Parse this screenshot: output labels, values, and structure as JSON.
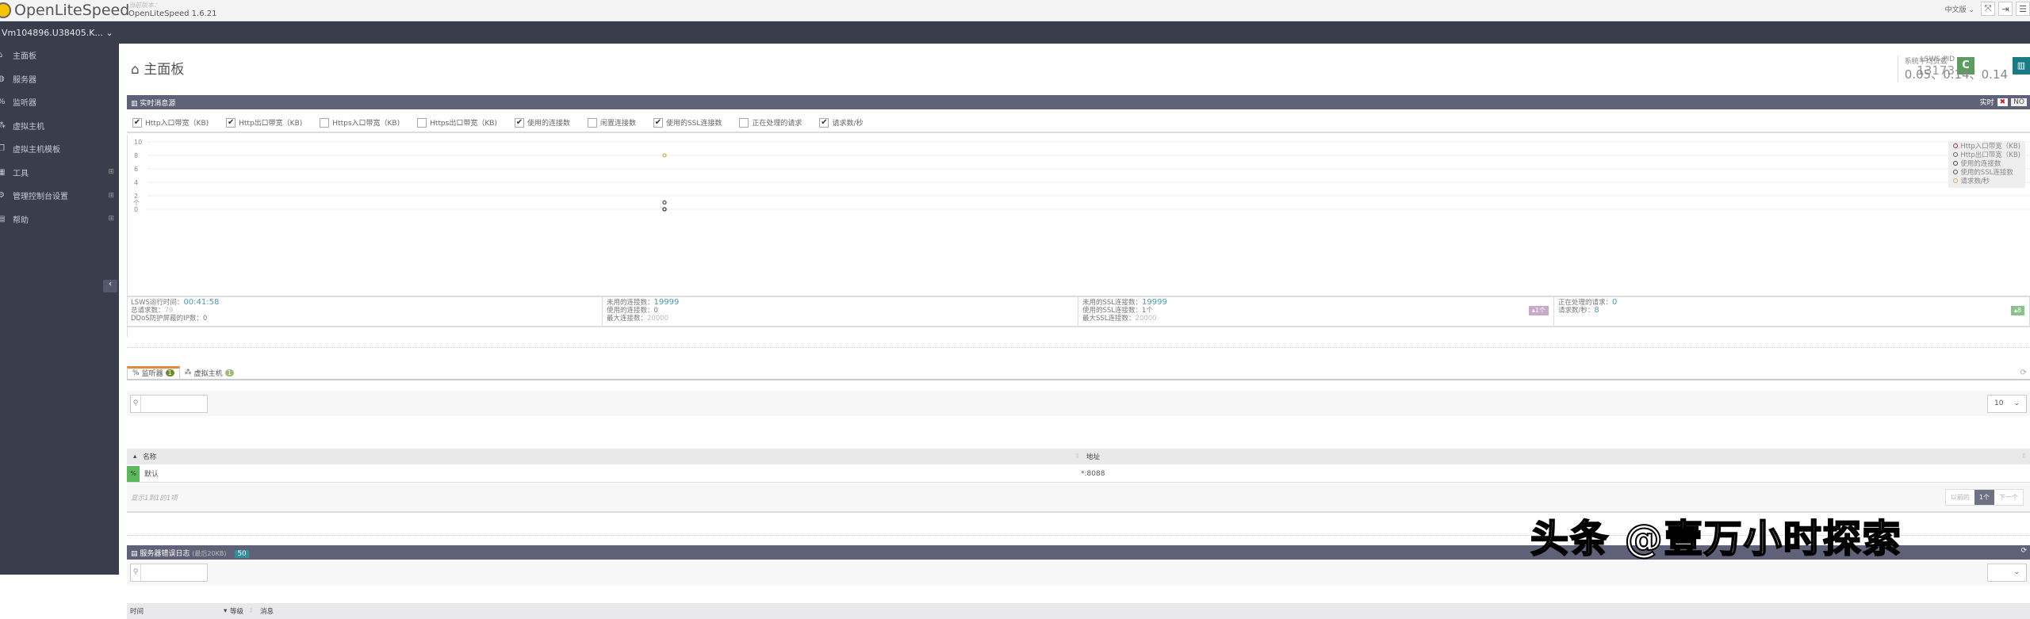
{
  "header": {
    "logo": "OpenLiteSpeed",
    "version_label": "当前版本：",
    "version": "OpenLiteSpeed 1.6.21",
    "language": "中文版",
    "server": "Vm104896.U38405.K..."
  },
  "sidebar": {
    "items": [
      {
        "label": "主面板",
        "icon": "home-icon"
      },
      {
        "label": "服务器",
        "icon": "globe-icon"
      },
      {
        "label": "监听器",
        "icon": "link-icon"
      },
      {
        "label": "虚拟主机",
        "icon": "cubes-icon"
      },
      {
        "label": "虚拟主机模板",
        "icon": "files-icon"
      },
      {
        "label": "工具",
        "icon": "grid-icon",
        "expand": "⊞"
      },
      {
        "label": "管理控制台设置",
        "icon": "gear-icon",
        "expand": "⊞"
      },
      {
        "label": "帮助",
        "icon": "book-icon",
        "expand": "⊞"
      }
    ]
  },
  "page": {
    "title": "主面板",
    "pid_label": "LSWS PID",
    "pid": "13173",
    "load_label": "系统平均负载",
    "load": "0.05、0.14、0.14"
  },
  "realtime": {
    "title": "实时消息源",
    "toggle_label": "实时",
    "toggle_value": "NO",
    "checkboxes": [
      {
        "label": "Http入口带宽（KB)",
        "checked": true
      },
      {
        "label": "Http出口带宽（KB)",
        "checked": true
      },
      {
        "label": "Https入口带宽（KB)",
        "checked": false
      },
      {
        "label": "Https出口带宽（KB)",
        "checked": false
      },
      {
        "label": "使用的连接数",
        "checked": true
      },
      {
        "label": "闲置连接数",
        "checked": false
      },
      {
        "label": "使用的SSL连接数",
        "checked": true
      },
      {
        "label": "正在处理的请求",
        "checked": false
      },
      {
        "label": "请求数/秒",
        "checked": true
      }
    ]
  },
  "chart_data": {
    "type": "scatter",
    "ylim": [
      0,
      10
    ],
    "yticks": [
      "0",
      "2",
      "4",
      "6",
      "8",
      "10"
    ],
    "ylabel": "个",
    "legend_position": "top-right",
    "series": [
      {
        "name": "Http入口带宽（KB)",
        "color": "#b03a3a",
        "values": [
          0
        ]
      },
      {
        "name": "Http出口带宽（KB)",
        "color": "#666666",
        "values": [
          0
        ]
      },
      {
        "name": "使用的连接数",
        "color": "#444444",
        "values": [
          0
        ]
      },
      {
        "name": "使用的SSL连接数",
        "color": "#555566",
        "values": [
          1
        ]
      },
      {
        "name": "请求数/秒",
        "color": "#c8b25a",
        "values": [
          8
        ]
      }
    ]
  },
  "stats": [
    {
      "rows": [
        {
          "label": "LSWS运行时间：",
          "value": "00:41:58"
        },
        {
          "label": "总请求数：",
          "value": "79"
        },
        {
          "label": "DDoS防护屏蔽的IP数：",
          "value": "0"
        }
      ]
    },
    {
      "rows": [
        {
          "label": "未用的连接数：",
          "value": "19999"
        },
        {
          "label": "使用的连接数：",
          "value": "0"
        },
        {
          "label": "最大连接数：",
          "value": "20000"
        }
      ]
    },
    {
      "rows": [
        {
          "label": "未用的SSL连接数：",
          "value": "19999"
        },
        {
          "label": "使用的SSL连接数：",
          "value": "1个"
        },
        {
          "label": "最大SSL连接数：",
          "value": "20000"
        }
      ],
      "badge": "▴1个"
    },
    {
      "rows": [
        {
          "label": "正在处理的请求：",
          "value": "0"
        },
        {
          "label": "请求数/秒：",
          "value": "8"
        }
      ],
      "badge": "▴8"
    }
  ],
  "listeners": {
    "tabs": [
      {
        "label": "监听器",
        "count": "1"
      },
      {
        "label": "虚拟主机",
        "count": "1"
      }
    ],
    "page_size": "10",
    "columns": [
      "名称",
      "地址"
    ],
    "rows": [
      {
        "name": "默认",
        "address": "*:8088"
      }
    ],
    "info": "显示1到1的1项",
    "pager": {
      "prev": "以前的",
      "current": "1个",
      "next": "下一个"
    }
  },
  "errorlog": {
    "title": "服务器错误日志",
    "subtitle": "(最后20KB)",
    "count": "50",
    "columns": [
      "时间",
      "等级",
      "消息"
    ]
  },
  "watermark": "头条 @壹万小时探索"
}
